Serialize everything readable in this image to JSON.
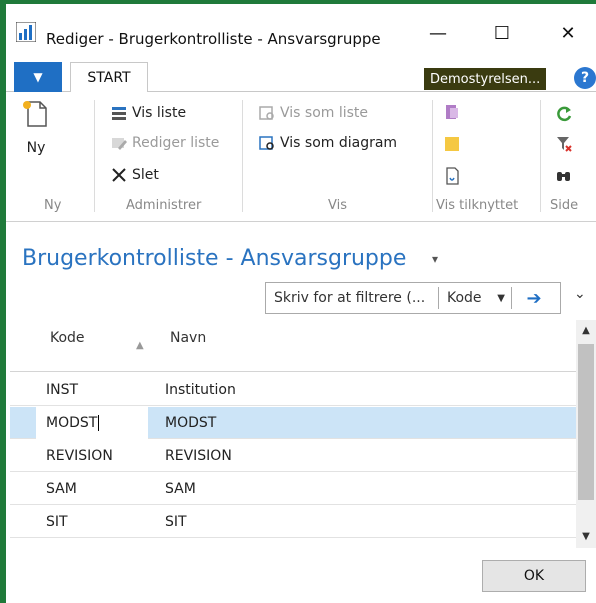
{
  "window": {
    "title": "Rediger - Brugerkontrolliste  - Ansvarsgruppe",
    "minimize": "—",
    "maximize": "☐",
    "close": "✕"
  },
  "ribbon_tabs": {
    "menu": "▼",
    "start": "START",
    "company": "Demostyrelsen...",
    "help": "?"
  },
  "ribbon": {
    "groups": {
      "ny": "Ny",
      "administrer": "Administrer",
      "vis": "Vis",
      "vis_tilknyttet": "Vis tilknyttet",
      "side": "Side"
    },
    "new_label": "Ny",
    "vis_liste": "Vis liste",
    "rediger_liste": "Rediger liste",
    "slet": "Slet",
    "vis_som_liste": "Vis som liste",
    "vis_som_diagram": "Vis som diagram"
  },
  "page": {
    "title": "Brugerkontrolliste  - Ansvarsgruppe",
    "title_arrow": "▾"
  },
  "filter": {
    "placeholder": "Skriv for at filtrere (...",
    "field": "Kode",
    "field_arrow": "▼",
    "go": "➔",
    "collapse": "⌄"
  },
  "list": {
    "columns": [
      "Kode",
      "Navn"
    ],
    "sort_arrow": "▲",
    "rows": [
      {
        "kode": "INST",
        "navn": "Institution"
      },
      {
        "kode": "MODST",
        "navn": "MODST"
      },
      {
        "kode": "REVISION",
        "navn": "REVISION"
      },
      {
        "kode": "SAM",
        "navn": "SAM"
      },
      {
        "kode": "SIT",
        "navn": "SIT"
      }
    ]
  },
  "scrollbar": {
    "up": "▲",
    "down": "▼"
  },
  "footer": {
    "ok": "OK"
  },
  "colors": {
    "frame": "#1f7a3a",
    "accent": "#1f6fc4",
    "title_blue": "#2a73c0",
    "selected_row": "#cce4f7",
    "company_badge": "#3a3b10"
  }
}
